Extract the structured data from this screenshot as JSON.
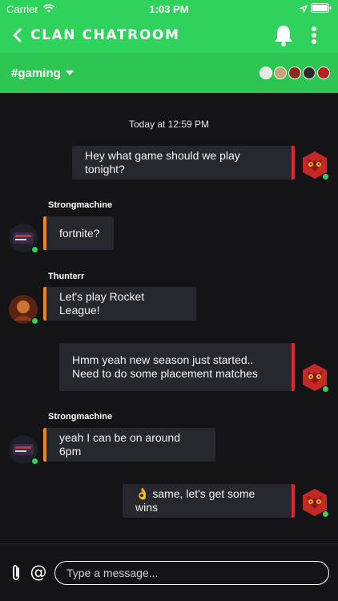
{
  "status_bar": {
    "carrier": "Carrier",
    "time": "1:03 PM"
  },
  "header": {
    "title": "CLAN CHATROOM"
  },
  "channel": {
    "name": "#gaming"
  },
  "chat": {
    "timestamp": "Today at 12:59 PM",
    "messages": [
      {
        "direction": "out",
        "text": "Hey what game should we play tonight?"
      },
      {
        "direction": "in",
        "sender": "Strongmachine",
        "text": "fortnite?"
      },
      {
        "direction": "in",
        "sender": "Thunterr",
        "text": "Let's play Rocket League!"
      },
      {
        "direction": "out",
        "text": "Hmm yeah new season just started.. Need to do some placement matches"
      },
      {
        "direction": "in",
        "sender": "Strongmachine",
        "text": "yeah I can be on around 6pm"
      },
      {
        "direction": "out",
        "text": "👌 same, let's get some wins"
      }
    ]
  },
  "composer": {
    "placeholder": "Type a message...",
    "mention_symbol": "@"
  },
  "colors": {
    "brand_green": "#2fd25a",
    "incoming_accent": "#f5821f",
    "outgoing_accent": "#e0262b",
    "online": "#34d15a"
  }
}
